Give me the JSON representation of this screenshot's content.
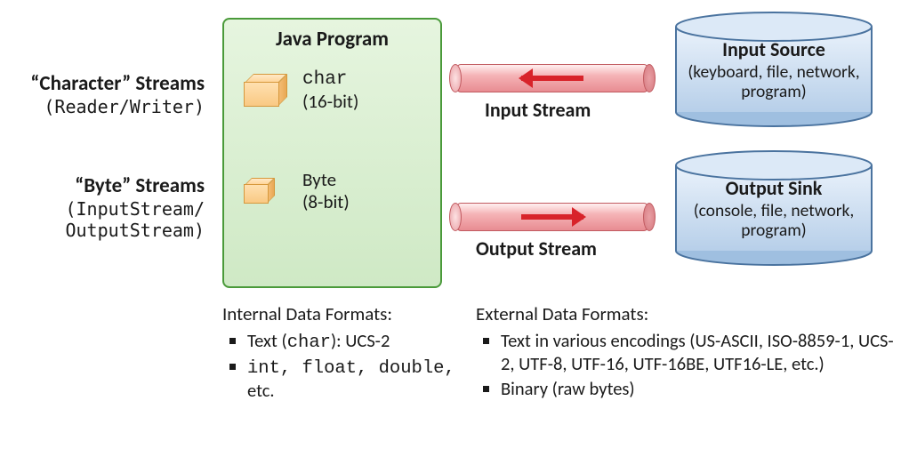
{
  "leftLabels": {
    "charStreams": {
      "title": "“Character” Streams",
      "sub": "(Reader/Writer)"
    },
    "byteStreams": {
      "title": "“Byte” Streams",
      "sub1": "(InputStream/",
      "sub2": "OutputStream)"
    }
  },
  "javaProgram": {
    "title": "Java Program",
    "char": {
      "name": "char",
      "bits": "(16-bit)"
    },
    "byte": {
      "name": "Byte",
      "bits": "(8-bit)"
    }
  },
  "pipes": {
    "input": "Input Stream",
    "output": "Output Stream"
  },
  "cylinders": {
    "input": {
      "title": "Input Source",
      "desc": "(keyboard, file, network, program)"
    },
    "output": {
      "title": "Output Sink",
      "desc": "(console, file, network, program)"
    }
  },
  "internal": {
    "header": "Internal Data Formats:",
    "items": [
      "Text (char): UCS-2",
      "int, float, double, etc."
    ]
  },
  "external": {
    "header": "External Data Formats:",
    "items": [
      "Text in various encodings (US-ASCII, ISO-8859-1, UCS-2, UTF-8, UTF-16, UTF-16BE, UTF16-LE, etc.)",
      "Binary (raw bytes)"
    ]
  }
}
